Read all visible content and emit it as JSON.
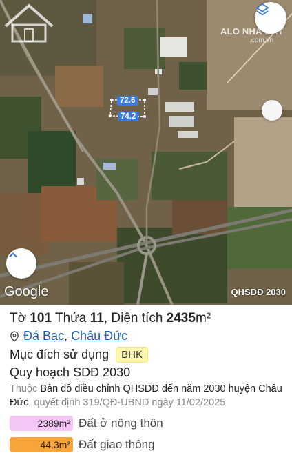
{
  "map": {
    "dimension_top": "72.6",
    "dimension_bottom": "74.2",
    "google_label": "Google",
    "layer_label": "QHSDĐ 2030",
    "watermark": "ALO NHÀ ĐẤT",
    "watermark_sub": ".com.vn",
    "layers_icon": "layers-icon",
    "up_icon": "chevron-up-icon"
  },
  "panel": {
    "title_prefix": "Tờ",
    "sheet": "101",
    "parcel_label": "Thửa",
    "parcel": "11",
    "area_label": ", Diện tích",
    "area_value": "2435",
    "area_unit": "m²",
    "location_1": "Đá Bạc",
    "location_sep": ",",
    "location_2": "Châu Đức",
    "purpose_label": "Mục đích sử dụng",
    "purpose_code": "BHK",
    "plan_title": "Quy hoạch SDĐ 2030",
    "desc_prefix": "Thuộc",
    "desc_main": "Bản đồ điều chỉnh QHSDĐ đến năm 2030 huyện Châu Đức",
    "desc_suffix": ", quyết định 319/QĐ-UBND ngày 11/02/2025",
    "legend": [
      {
        "value": "2389m²",
        "label": "Đất ở nông thôn",
        "color": "#f5c6f5"
      },
      {
        "value": "44.3m²",
        "label": "Đất giao thông",
        "color": "#f7a43a"
      }
    ]
  }
}
